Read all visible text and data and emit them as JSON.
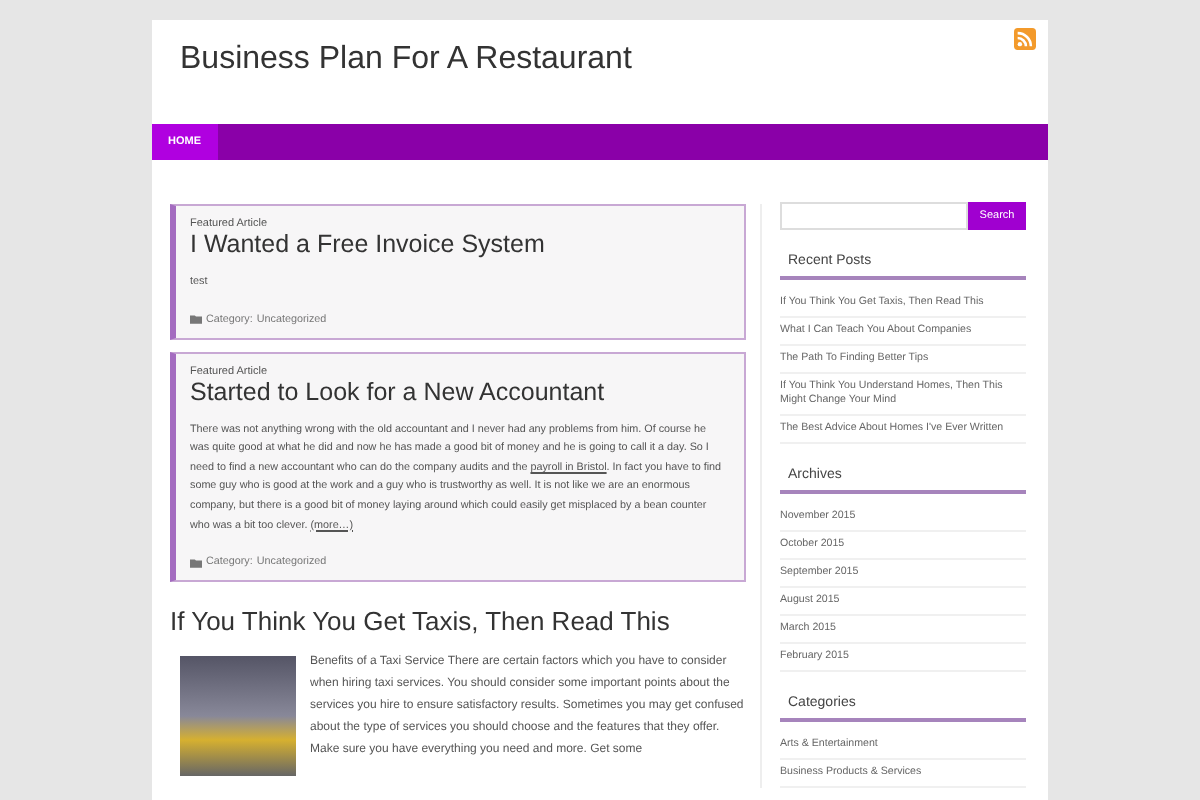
{
  "header": {
    "site_title": "Business Plan For A Restaurant"
  },
  "nav": {
    "items": [
      {
        "label": "HOME",
        "selected": true
      }
    ]
  },
  "featured": [
    {
      "label": "Featured Article",
      "title": "I Wanted a Free Invoice System",
      "body": [
        {
          "kind": "text",
          "text": "test"
        }
      ],
      "category_label": "Category:",
      "category": "Uncategorized"
    },
    {
      "label": "Featured Article",
      "title": "Started to Look for a New Accountant",
      "body": [
        {
          "kind": "text",
          "text": "There was not anything wrong with the old accountant and I never had any problems from him. Of course he was quite good at what he did and now he has made a good bit of money and he is going to call it a day. So I need to find a new accountant who can do the company audits and the "
        },
        {
          "kind": "link",
          "text": "payroll in Bristol"
        },
        {
          "kind": "text",
          "text": ". In fact you have to find some guy who is good at the work and a guy who is trustworthy as well. It is not like we are an enormous company, but there is a good bit of money laying around which could easily get misplaced by a bean counter who was a bit too clever. "
        },
        {
          "kind": "link",
          "text": "(more…)"
        }
      ],
      "category_label": "Category:",
      "category": "Uncategorized"
    }
  ],
  "article": {
    "title": "If You Think You Get Taxis, Then Read This",
    "excerpt": "Benefits of a Taxi Service There are certain factors which you have to consider when hiring taxi services. You should consider some important points about the services you hire to ensure satisfactory results. Sometimes you may get confused about the type of services you should choose and the features that they offer. Make sure you have everything you need and more. Get some"
  },
  "sidebar": {
    "search_button": "Search",
    "widgets": [
      {
        "title": "Recent Posts",
        "items": [
          "If You Think You Get Taxis, Then Read This",
          "What I Can Teach You About Companies",
          "The Path To Finding Better Tips",
          "If You Think You Understand Homes, Then This Might Change Your Mind",
          "The Best Advice About Homes I've Ever Written"
        ]
      },
      {
        "title": "Archives",
        "items": [
          "November 2015",
          "October 2015",
          "September 2015",
          "August 2015",
          "March 2015",
          "February 2015"
        ]
      },
      {
        "title": "Categories",
        "items": [
          "Arts & Entertainment",
          "Business Products & Services"
        ]
      }
    ]
  }
}
